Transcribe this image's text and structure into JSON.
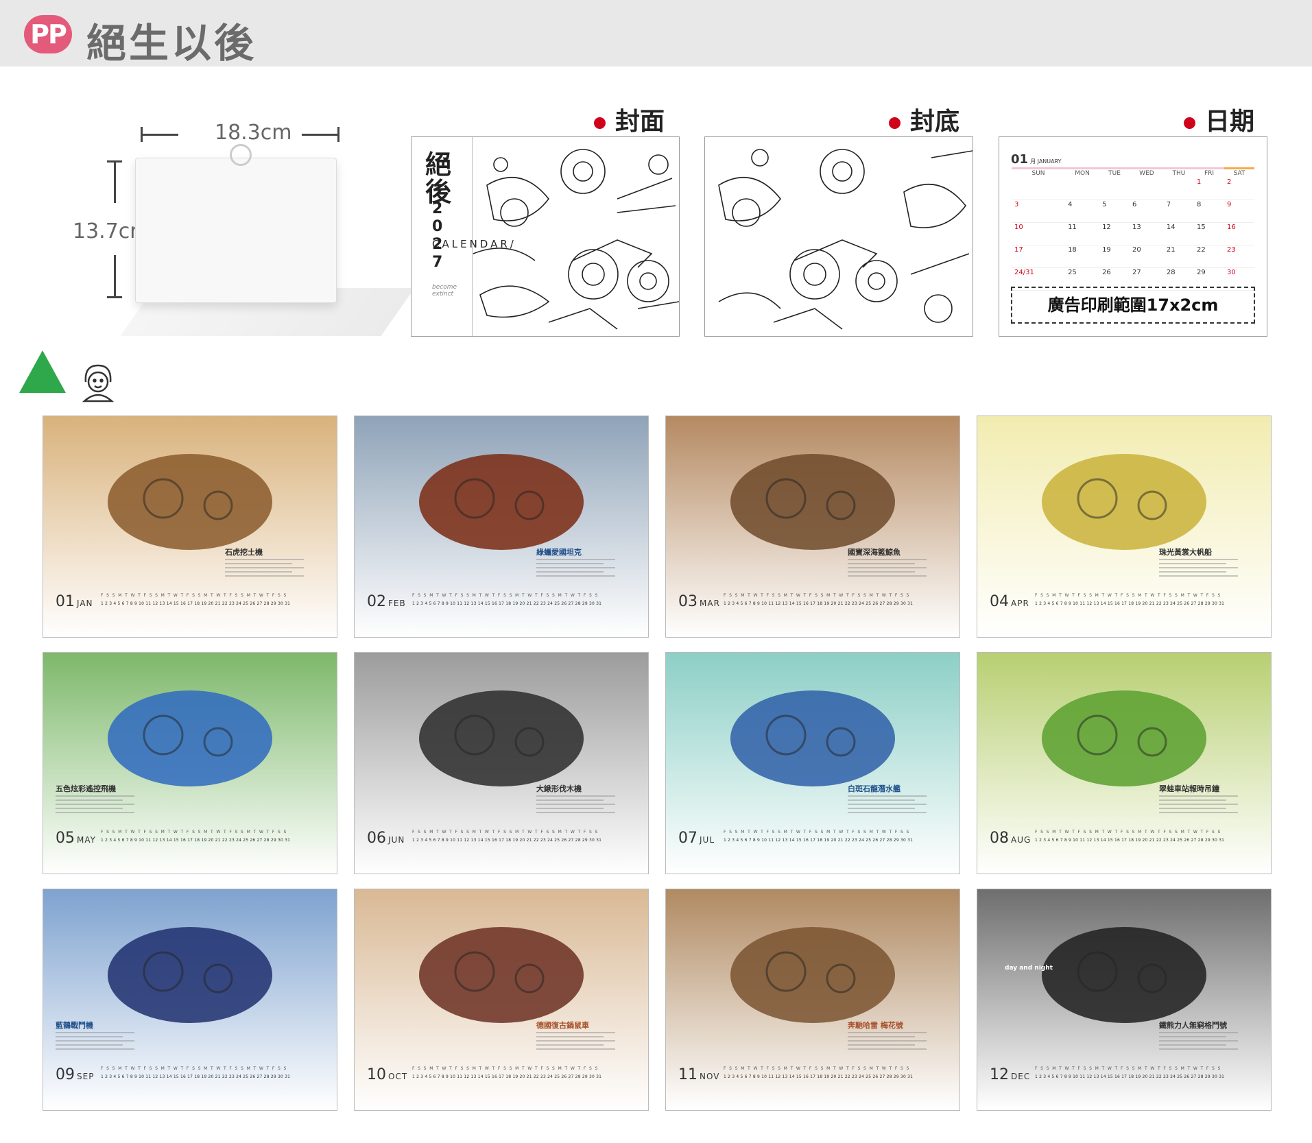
{
  "header": {
    "logo": "PP",
    "title": "絕生以後"
  },
  "product": {
    "width_label": "18.3cm",
    "height_label": "13.7cm"
  },
  "sections": {
    "front": "封面",
    "back": "封底",
    "dates": "日期"
  },
  "cover": {
    "kanji_top": "絕",
    "kanji_bottom": "後",
    "year": "2027",
    "calendar_text": "CALENDAR/",
    "small_text": "become extinct"
  },
  "date_preview": {
    "month_label": "01",
    "month_name": "月 JANUARY",
    "weekdays": [
      "SUN",
      "MON",
      "TUE",
      "WED",
      "THU",
      "FRI",
      "SAT"
    ],
    "weeks": [
      [
        "",
        "",
        "",
        "",
        "",
        "1",
        "2"
      ],
      [
        "3",
        "4",
        "5",
        "6",
        "7",
        "8",
        "9"
      ],
      [
        "10",
        "11",
        "12",
        "13",
        "14",
        "15",
        "16"
      ],
      [
        "17",
        "18",
        "19",
        "20",
        "21",
        "22",
        "23"
      ],
      [
        "24/31",
        "25",
        "26",
        "27",
        "28",
        "29",
        "30"
      ]
    ],
    "ad_text": "廣告印刷範圍17x2cm"
  },
  "months": [
    {
      "num": "01",
      "abbr": "JAN",
      "caption": "石虎挖土機",
      "bg": [
        "#d9b27c",
        "#ffffff"
      ],
      "art": "#8a5a2b"
    },
    {
      "num": "02",
      "abbr": "FEB",
      "caption": "綠蠵愛國坦克",
      "bg": [
        "#8fa3b8",
        "#ffffff"
      ],
      "art": "#7a2a12"
    },
    {
      "num": "03",
      "abbr": "MAR",
      "caption": "國寶深海籃鯨魚",
      "bg": [
        "#b58a62",
        "#ffffff"
      ],
      "art": "#6e4a2a"
    },
    {
      "num": "04",
      "abbr": "APR",
      "caption": "珠光黃裳大帆船",
      "bg": [
        "#f2ecb0",
        "#ffffff"
      ],
      "art": "#c9b13a"
    },
    {
      "num": "05",
      "abbr": "MAY",
      "caption": "五色炫彩遙控飛機",
      "bg": [
        "#7db86a",
        "#ffffff"
      ],
      "art": "#2f6ac0"
    },
    {
      "num": "06",
      "abbr": "JUN",
      "caption": "大鍬形伐木機",
      "bg": [
        "#9c9c9c",
        "#ffffff"
      ],
      "art": "#2b2b2b"
    },
    {
      "num": "07",
      "abbr": "JUL",
      "caption": "白斑石龍潛水艦",
      "bg": [
        "#8ccfc6",
        "#ffffff"
      ],
      "art": "#2f5fa8"
    },
    {
      "num": "08",
      "abbr": "AUG",
      "caption": "翠蛙車站報時吊鐘",
      "bg": [
        "#b8cf72",
        "#ffffff"
      ],
      "art": "#5aa02f"
    },
    {
      "num": "09",
      "abbr": "SEP",
      "caption": "藍鵲戰鬥機",
      "bg": [
        "#7ea2cf",
        "#ffffff"
      ],
      "art": "#1f2f6e"
    },
    {
      "num": "10",
      "abbr": "OCT",
      "caption": "德國復古鍋鼠車",
      "bg": [
        "#d9b995",
        "#ffffff"
      ],
      "art": "#6b2f22"
    },
    {
      "num": "11",
      "abbr": "NOV",
      "caption": "奔馳哈雷 梅花號",
      "bg": [
        "#b08a62",
        "#ffffff"
      ],
      "art": "#7a5330"
    },
    {
      "num": "12",
      "abbr": "DEC",
      "caption": "鐵熊力人無窮格鬥號",
      "bg": [
        "#6e6e6e",
        "#ffffff"
      ],
      "art": "#1f1f1f"
    }
  ],
  "week_letters": "F S S M T W T F S S M T W T F S S M T W T F S S M T W T F S S",
  "day_numbers": "1 2 3 4 5 6 7 8 9 10 11 12 13 14 15 16 17 18 19 20 21 22 23 24 25 26 27 28 29 30 31",
  "dec_caption_extra": "day and night",
  "colors": {
    "accent_red": "#d0021b",
    "header_bg": "#e8e8e8",
    "logo_pink": "#e35a7a",
    "triangle_green": "#2ea84a"
  }
}
